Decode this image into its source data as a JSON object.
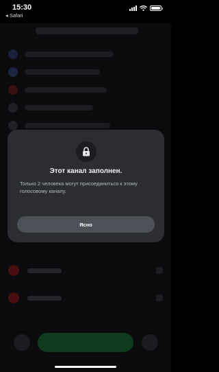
{
  "status_bar": {
    "time": "15:30",
    "back_app": "◂ Safari",
    "icons": [
      "signal-icon",
      "wifi-icon",
      "battery-icon"
    ]
  },
  "modal": {
    "icon": "lock-icon",
    "title": "Этот канал заполнен.",
    "description": "Только 2 человека могут присоединиться к этому голосовому каналу.",
    "ok_label": "Ясно"
  },
  "colors": {
    "modal_bg": "#2b2d31",
    "button_bg": "#4e5058",
    "overlay_bg": "#0b0b0d"
  }
}
